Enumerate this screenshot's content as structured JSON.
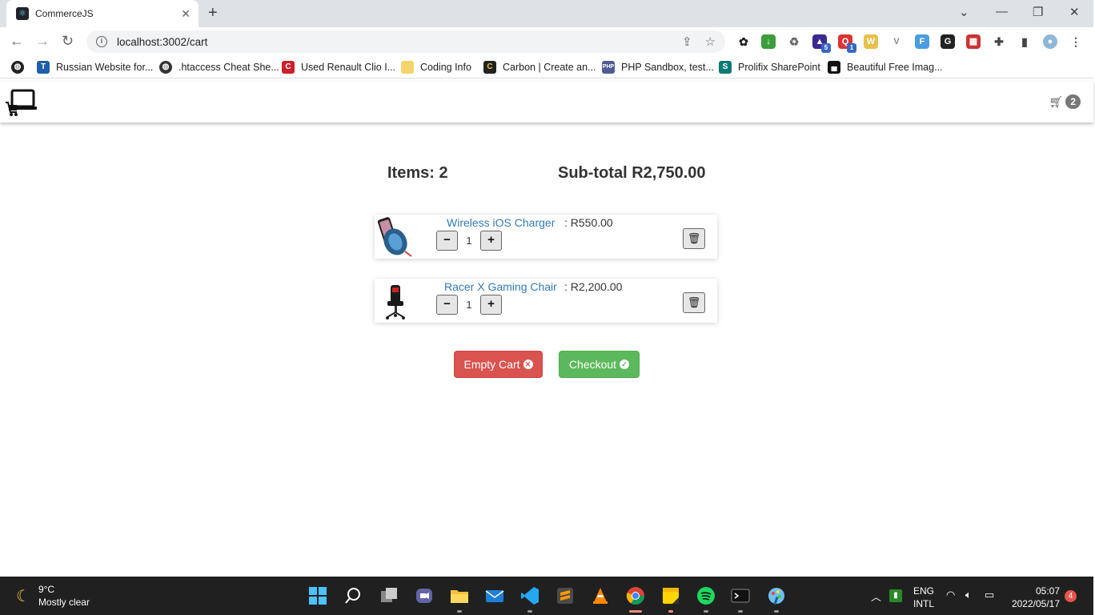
{
  "browser": {
    "tab_title": "CommerceJS",
    "tab_close": "✕",
    "new_tab": "+",
    "url": "localhost:3002/cart",
    "bookmarks": [
      "Russian Website for...",
      ".htaccess Cheat She...",
      "Used Renault Clio I...",
      "Coding Info",
      "Carbon | Create an...",
      "PHP Sandbox, test...",
      "Prolifix SharePoint",
      "Beautiful Free Imag..."
    ],
    "extension_badges": [
      "5",
      "1"
    ]
  },
  "header": {
    "cart_icon": "cart-icon",
    "cart_count": "2"
  },
  "cart": {
    "items_label": "Items: 2",
    "subtotal_label": "Sub-total R2,750.00",
    "items": [
      {
        "name": "Wireless iOS Charger",
        "price": ": R550.00",
        "quantity": "1",
        "minus": "−",
        "plus": "+"
      },
      {
        "name": "Racer X Gaming Chair",
        "price": ": R2,200.00",
        "quantity": "1",
        "minus": "−",
        "plus": "+"
      }
    ],
    "empty_button": "Empty Cart",
    "checkout_button": "Checkout"
  },
  "taskbar": {
    "temperature": "9°C",
    "weather": "Mostly clear",
    "lang_1": "ENG",
    "lang_2": "INTL",
    "time": "05:07",
    "date": "2022/05/17",
    "notifications": "4"
  },
  "colors": {
    "danger": "#d9534f",
    "success": "#5cb85c",
    "link": "#337ab7"
  }
}
